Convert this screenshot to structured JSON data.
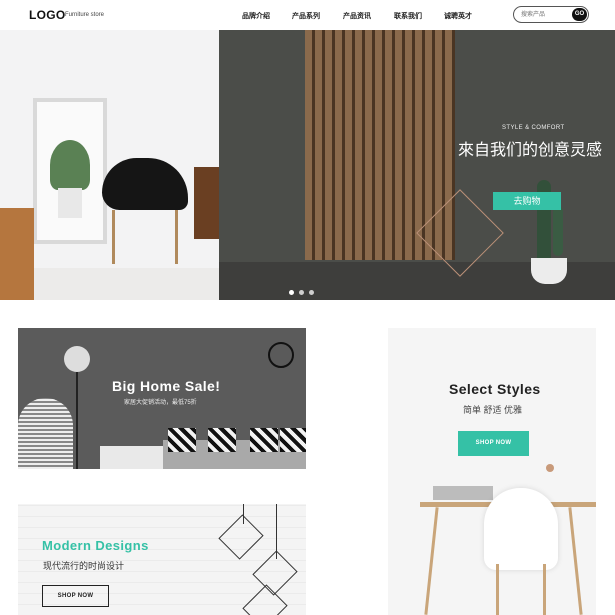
{
  "header": {
    "logo": "LOGO",
    "logo_sub": "Furniture store",
    "nav": [
      "品牌介绍",
      "产品系列",
      "产品资讯",
      "联系我们",
      "诚聘英才"
    ],
    "search_placeholder": "搜索产品",
    "search_button": "GO"
  },
  "hero": {
    "kicker": "STYLE & COMFORT",
    "title": "來自我们的创意灵感",
    "button": "去购物",
    "dots": 3,
    "active_dot": 0
  },
  "banners": {
    "sale": {
      "title": "Big Home Sale!",
      "subtitle": "家居大促销活动，最低75折"
    },
    "styles": {
      "title": "Select Styles",
      "subtitle": "简单 舒适 优雅",
      "button": "SHOP NOW"
    },
    "modern": {
      "title": "Modern Designs",
      "subtitle": "现代流行的时尚设计",
      "button": "SHOP NOW"
    }
  },
  "colors": {
    "accent": "#35c1a6",
    "dark": "#111111"
  }
}
